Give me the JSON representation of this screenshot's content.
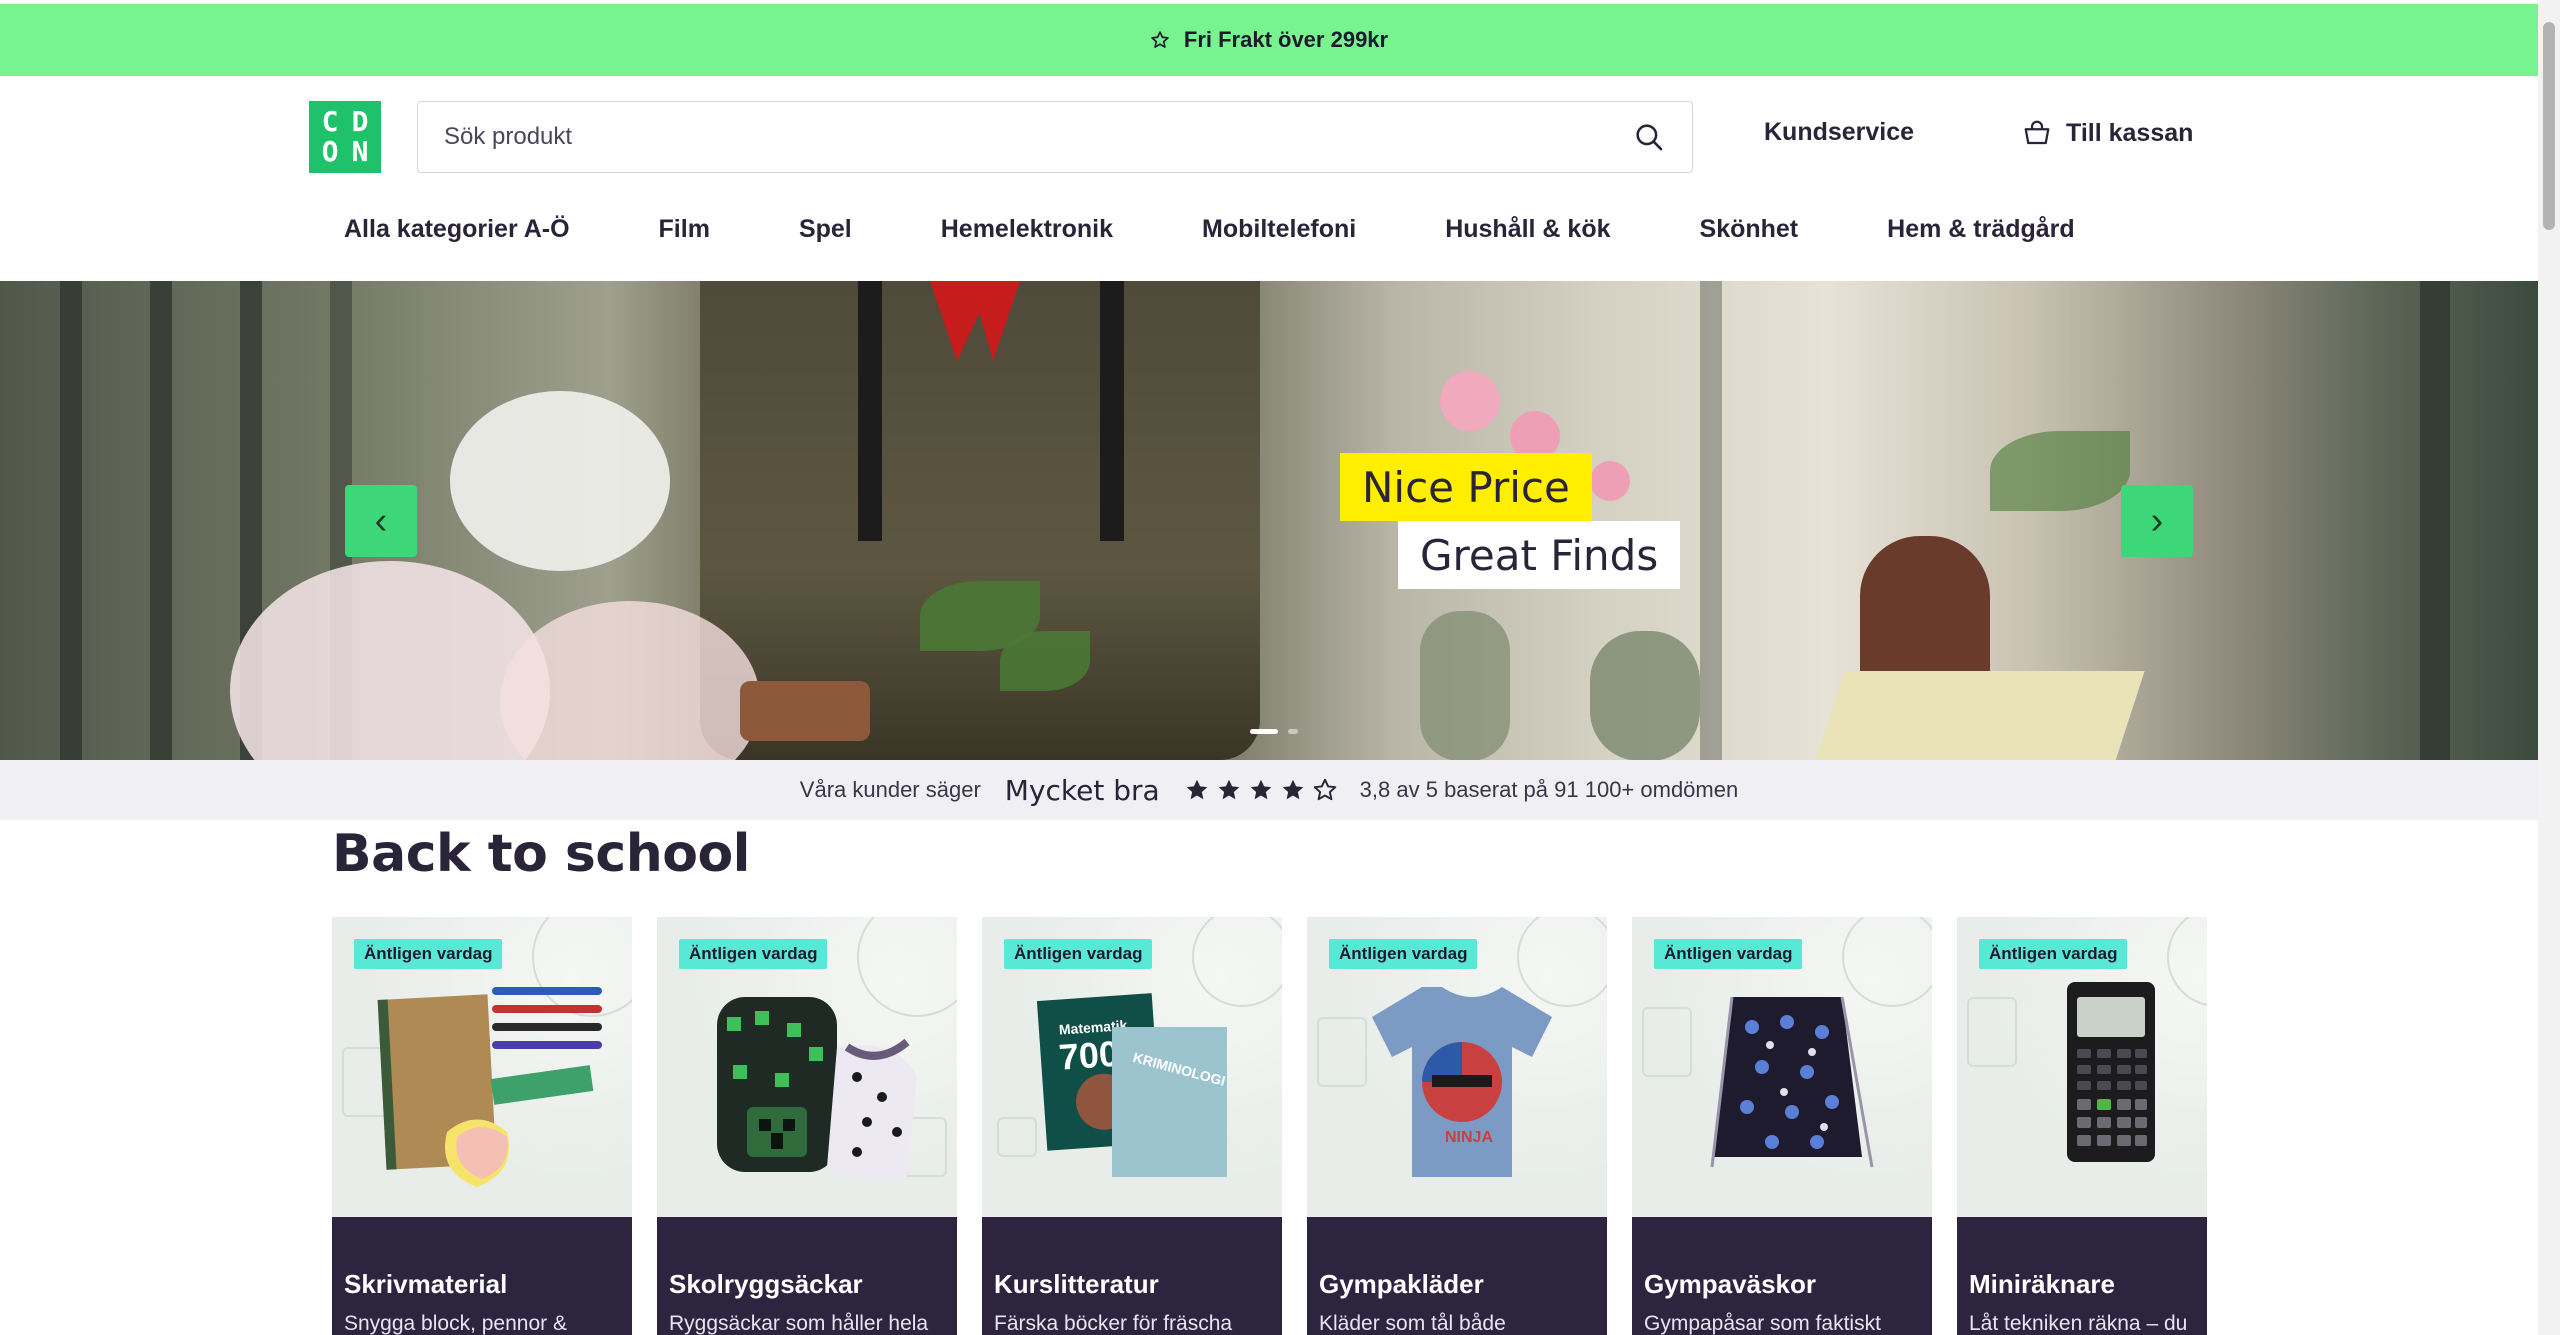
{
  "promo": {
    "icon": "star-outline-icon",
    "text": "Fri Frakt över 299kr"
  },
  "logo": {
    "letters": [
      "C",
      "D",
      "O",
      "N"
    ],
    "color": "#1fc26a"
  },
  "search": {
    "placeholder": "Sök produkt",
    "value": "",
    "icon": "search-icon"
  },
  "header": {
    "kundservice": "Kundservice",
    "checkout_label": "Till kassan",
    "checkout_icon": "basket-icon"
  },
  "nav": {
    "items": [
      {
        "label": "Alla kategorier A-Ö"
      },
      {
        "label": "Film"
      },
      {
        "label": "Spel"
      },
      {
        "label": "Hemelektronik"
      },
      {
        "label": "Mobiltelefoni"
      },
      {
        "label": "Hushåll & kök"
      },
      {
        "label": "Skönhet"
      },
      {
        "label": "Hem & trädgård"
      }
    ]
  },
  "hero": {
    "tag_line_1": "Nice Price",
    "tag_line_2": "Great Finds",
    "prev_icon": "chevron-left-icon",
    "next_icon": "chevron-right-icon",
    "prev_glyph": "‹",
    "next_glyph": "›",
    "slide_count": 2,
    "active_slide": 1,
    "accent": "#3dd77a"
  },
  "reviews": {
    "intro": "Våra kunder säger",
    "verdict": "Mycket bra",
    "rating": 3.8,
    "max_rating": 5,
    "score_text": "3,8 av 5 baserat på 91 100+ omdömen"
  },
  "section": {
    "title": "Back to school",
    "cards": [
      {
        "badge": "Äntligen vardag",
        "title": "Skrivmaterial",
        "desc": "Snygga block, pennor &",
        "image": "notebook-pens-image"
      },
      {
        "badge": "Äntligen vardag",
        "title": "Skolryggsäckar",
        "desc": "Ryggsäckar som håller hela",
        "image": "backpacks-image"
      },
      {
        "badge": "Äntligen vardag",
        "title": "Kurslitteratur",
        "desc": "Färska böcker för fräscha",
        "image": "books-image"
      },
      {
        "badge": "Äntligen vardag",
        "title": "Gympakläder",
        "desc": "Kläder som tål både",
        "image": "tshirt-image"
      },
      {
        "badge": "Äntligen vardag",
        "title": "Gympaväskor",
        "desc": "Gympapåsar som faktiskt",
        "image": "gym-bag-image"
      },
      {
        "badge": "Äntligen vardag",
        "title": "Miniräknare",
        "desc": "Låt tekniken räkna – du",
        "image": "calculator-image"
      }
    ]
  }
}
